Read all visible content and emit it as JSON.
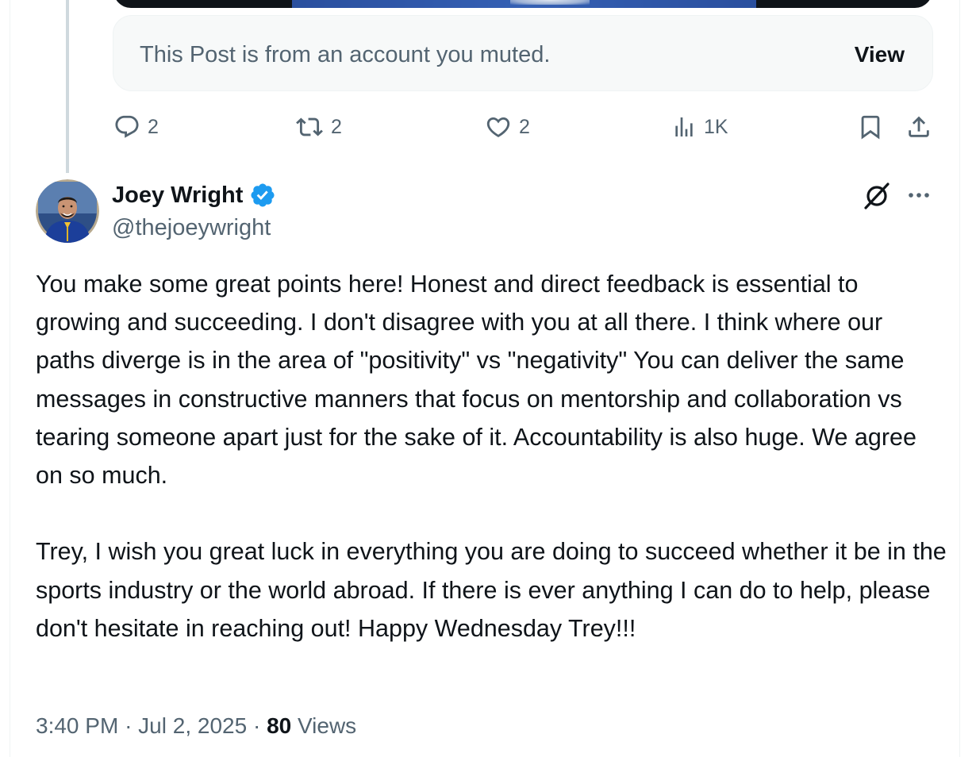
{
  "muted_notice": {
    "text": "This Post is from an account you muted.",
    "view_label": "View"
  },
  "actions": {
    "replies": "2",
    "reposts": "2",
    "likes": "2",
    "views": "1K"
  },
  "reply": {
    "display_name": "Joey Wright",
    "handle": "@thejoeywright",
    "body": "You make some great points here! Honest and direct feedback is essential to growing and succeeding. I don't disagree with you at all there. I think where our paths diverge is in the area of \"positivity\" vs \"negativity\" You can deliver the same messages in constructive manners that focus on mentorship and collaboration vs tearing someone apart just for the sake of it. Accountability is also huge. We agree on so much.\n\nTrey, I wish you great luck in everything you are doing to succeed whether it be in the sports industry or the world abroad. If there is ever anything I can do to help, please don't hesitate in reaching out! Happy Wednesday Trey!!!",
    "time": "3:40 PM",
    "separator": "·",
    "date": "Jul 2, 2025",
    "views_count": "80",
    "views_label": "Views"
  },
  "icons": {
    "reply": "reply-icon",
    "repost": "repost-icon",
    "like": "heart-icon",
    "analytics": "analytics-icon",
    "bookmark": "bookmark-icon",
    "share": "share-icon",
    "grok": "grok-icon",
    "more": "more-icon",
    "verified": "verified-badge-icon"
  },
  "colors": {
    "text_primary": "#0f1419",
    "text_secondary": "#536471",
    "verified_blue": "#1d9bf0",
    "thread_line": "#cfd9de",
    "muted_bg": "#f7f9f9"
  }
}
